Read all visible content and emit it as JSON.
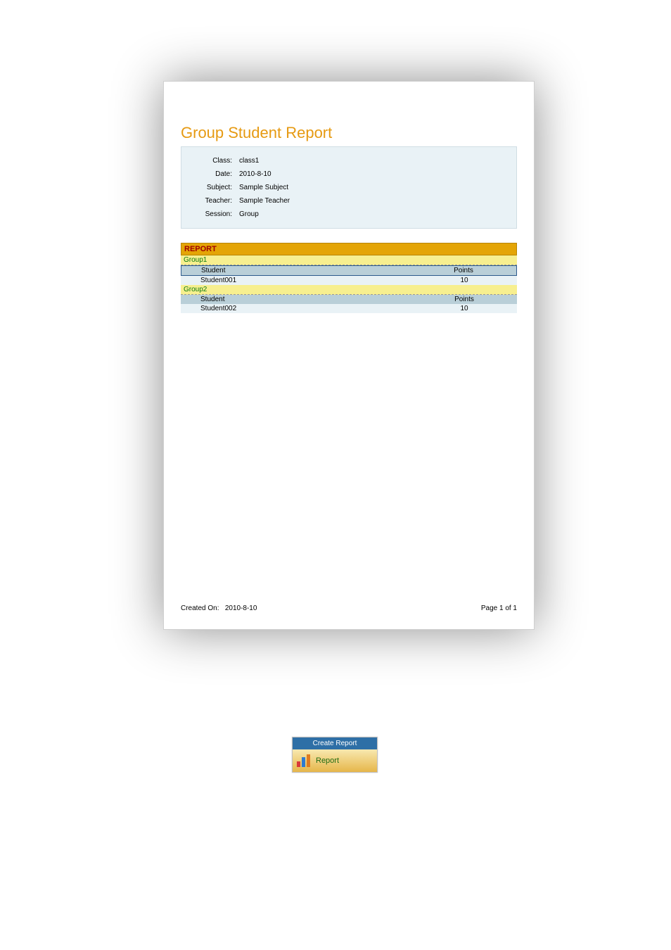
{
  "report": {
    "title": "Group Student Report",
    "info": {
      "class_label": "Class:",
      "class_value": "class1",
      "date_label": "Date:",
      "date_value": "2010-8-10",
      "subject_label": "Subject:",
      "subject_value": "Sample Subject",
      "teacher_label": "Teacher:",
      "teacher_value": "Sample Teacher",
      "session_label": "Session:",
      "session_value": "Group"
    },
    "section_title": "REPORT",
    "columns": {
      "student": "Student",
      "points": "Points"
    },
    "groups": [
      {
        "name": "Group1",
        "rows": [
          {
            "student": "Student001",
            "points": "10"
          }
        ]
      },
      {
        "name": "Group2",
        "rows": [
          {
            "student": "Student002",
            "points": "10"
          }
        ]
      }
    ],
    "footer": {
      "created_label": "Created On:",
      "created_value": "2010-8-10",
      "page_text": "Page 1 of 1"
    }
  },
  "button": {
    "title": "Create Report",
    "label": "Report"
  }
}
